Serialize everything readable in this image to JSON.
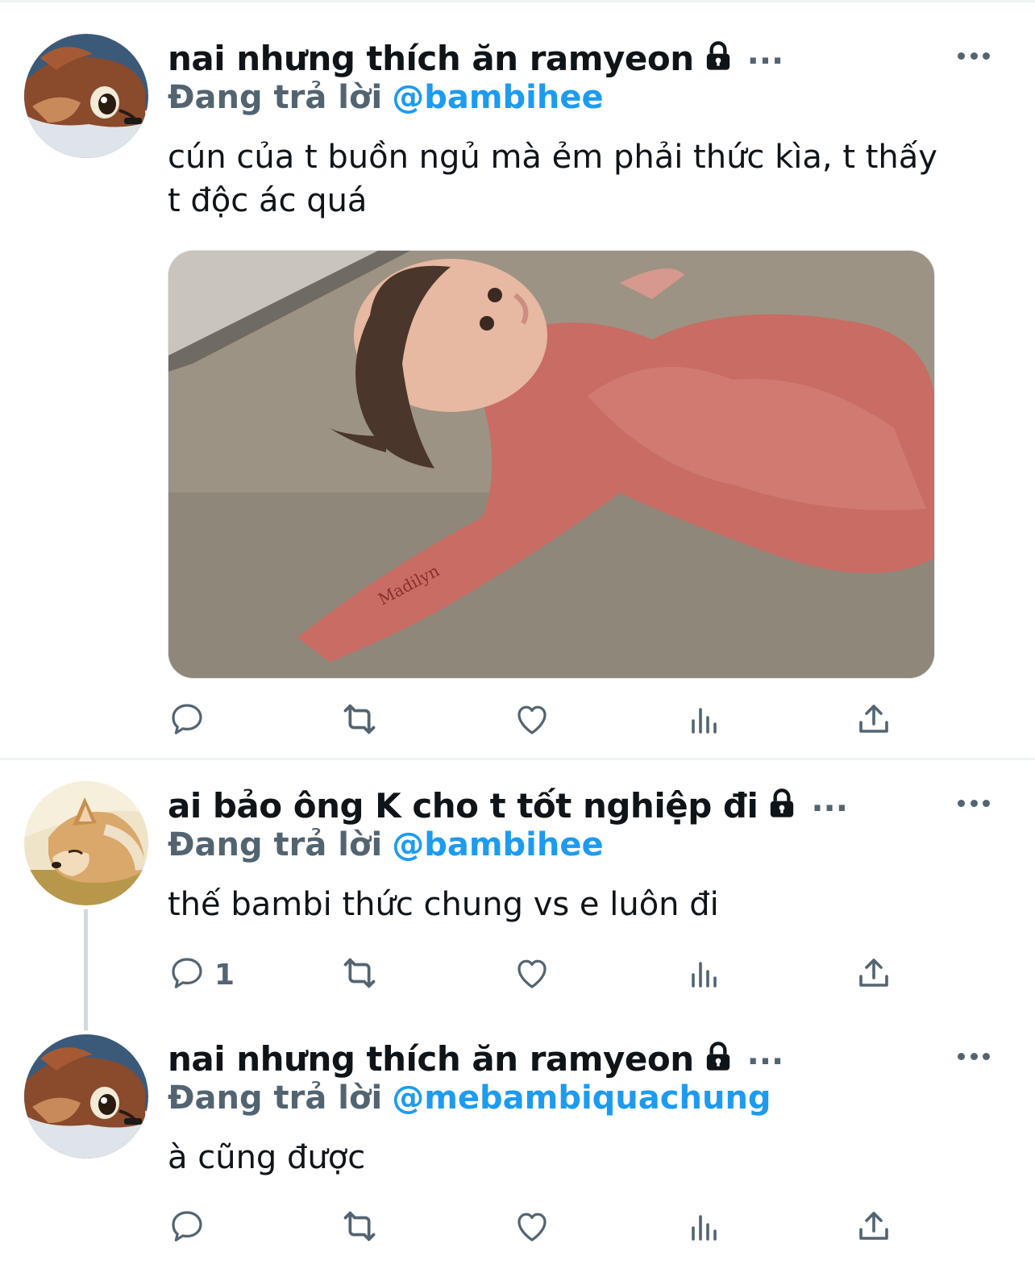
{
  "tweets": [
    {
      "name": "nai nhưng thích ăn ramyeon",
      "ellipsis": "...",
      "reply_label": "Đang trả lời",
      "reply_handle": "@bambihee",
      "text": "cún của t buồn ngủ mà ẻm phải thức kìa, t thấy t độc ác quá",
      "reply_count": "",
      "media_watermark": "Madilyn"
    },
    {
      "name": "ai bảo ông K cho t tốt nghiệp đi",
      "ellipsis": "...",
      "reply_label": "Đang trả lời",
      "reply_handle": "@bambihee",
      "text": "thế bambi thức chung vs e luôn đi",
      "reply_count": "1"
    },
    {
      "name": "nai nhưng thích ăn ramyeon",
      "ellipsis": "...",
      "reply_label": "Đang trả lời",
      "reply_handle": "@mebambiquachung",
      "text": "à cũng được",
      "reply_count": ""
    }
  ],
  "icons": [
    "lock-icon",
    "more-icon",
    "reply-icon",
    "retweet-icon",
    "like-icon",
    "views-icon",
    "share-icon"
  ],
  "colors": {
    "accent": "#1d9bf0",
    "secondary": "#536471",
    "text": "#0f1419",
    "divider": "#eff3f4"
  }
}
